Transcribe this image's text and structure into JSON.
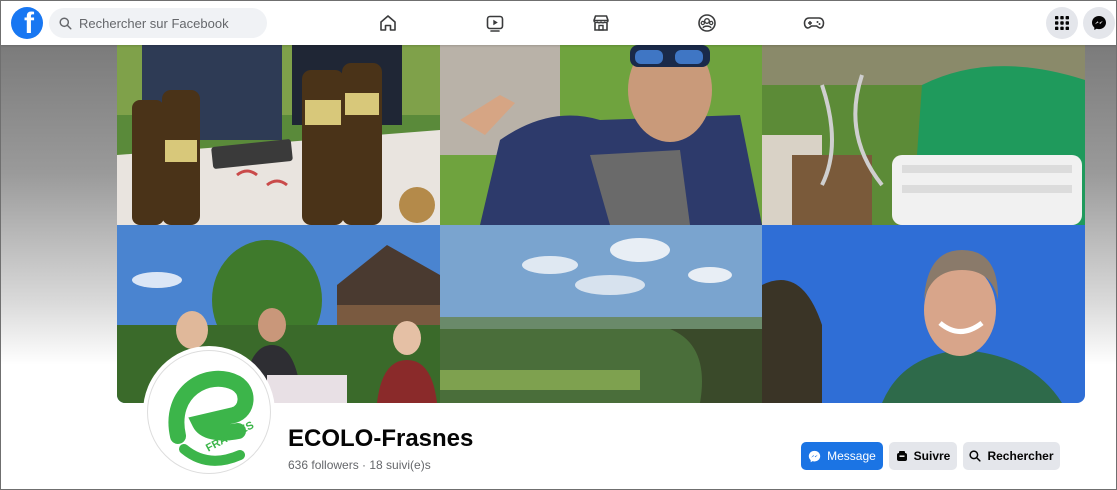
{
  "topbar": {
    "search_placeholder": "Rechercher sur Facebook",
    "logo_letter": "f",
    "nav": [
      "home-icon",
      "video-icon",
      "marketplace-icon",
      "groups-icon",
      "gaming-icon"
    ],
    "right": [
      "menu-grid-icon",
      "messenger-icon"
    ]
  },
  "profile": {
    "name": "ECOLO-Frasnes",
    "stats": "636 followers · 18 suivi(e)s",
    "logo_text": "FRASNES"
  },
  "actions": {
    "message": "Message",
    "follow": "Suivre",
    "search": "Rechercher"
  },
  "colors": {
    "facebook_blue": "#1877f2",
    "message_blue": "#1b74e4",
    "ecolo_green": "#3cb54a",
    "button_grey": "#e4e6eb"
  }
}
